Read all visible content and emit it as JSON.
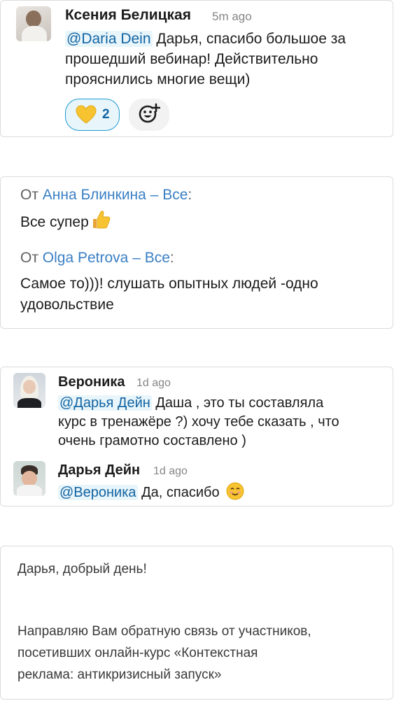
{
  "thread1": {
    "author": "Ксения Белицкая",
    "time": "5m ago",
    "mention": "@Daria Dein",
    "message_lines": [
      " Дарья, спасибо большое за",
      "прошедший вебинар! Действительно",
      "прояснились многие вещи)"
    ],
    "reaction": {
      "emoji": "yellow-heart",
      "count": "2"
    },
    "add_reaction_icon": "add-emoji-icon"
  },
  "chat_messages": [
    {
      "prefix": "От ",
      "sender": "Анна Блинкина",
      "separator": " – ",
      "recipient": "Все",
      "colon": ":",
      "text": "Все супер",
      "emoji": "thumbs-up"
    },
    {
      "prefix": "От ",
      "sender": "Olga Petrova",
      "separator": " – ",
      "recipient": "Все",
      "colon": ":",
      "text_lines": [
        "Самое то)))! слушать опытных людей -одно",
        "удовольствие"
      ]
    }
  ],
  "thread2": {
    "messages": [
      {
        "author": "Вероника",
        "time": "1d ago",
        "mention": "@Дарья Дейн",
        "lines": [
          " Даша , это ты составляла",
          "курс в тренажёре ?) хочу тебе сказать , что",
          "очень грамотно составлено )"
        ]
      },
      {
        "author": "Дарья Дейн",
        "time": "1d ago",
        "mention": "@Вероника",
        "text": " Да, спасибо",
        "emoji": "smiling-face"
      }
    ]
  },
  "letter": {
    "greeting": "Дарья, добрый день!",
    "body_lines": [
      "Направляю Вам обратную связь от участников,",
      "посетивших онлайн-курс «Контекстная",
      "реклама: антикризисный запуск»"
    ]
  },
  "colors": {
    "mention_bg": "#e8f5fa",
    "mention_text": "#1264a3",
    "link_blue": "#3a7fc4",
    "reaction_border": "#1d9bd1"
  }
}
